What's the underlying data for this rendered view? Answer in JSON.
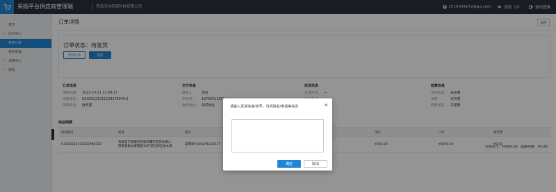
{
  "app": {
    "title": "采购平台供应商管理端",
    "company": "青岛闪动传媒科技有限公司"
  },
  "topbar": {
    "user_email": "1519334272@qq.com",
    "messages_label": "消息（2）",
    "logout_label": "退出登录"
  },
  "sidebar": {
    "items": [
      {
        "label": "首页",
        "arrow": ""
      },
      {
        "label": "比价中心",
        "arrow": "›"
      },
      {
        "label": "我的订单",
        "arrow": ""
      },
      {
        "label": "我的票据",
        "arrow": ""
      },
      {
        "label": "设置中心",
        "arrow": "›"
      },
      {
        "label": "帮助",
        "arrow": "›"
      }
    ]
  },
  "page": {
    "title": "订单详情",
    "back_label": "返回"
  },
  "status": {
    "text": "订单状态：待发货",
    "print_label": "打印订单",
    "ship_label": "发货"
  },
  "order_info": {
    "title": "订单信息",
    "rows": [
      {
        "k": "采购日期：",
        "v": "2022-10-11 11:59:17"
      },
      {
        "k": "采购单号：",
        "v": "O1920221011159176049-2"
      },
      {
        "k": "采购单位：",
        "v": "财务部"
      }
    ]
  },
  "delivery_info": {
    "title": "交付信息",
    "rows": [
      {
        "k": "联系人：",
        "v": "测试"
      },
      {
        "k": "手机号：",
        "v": "18765411851"
      },
      {
        "k": "收货地址：",
        "v": "测试地址"
      }
    ]
  },
  "receipt_info": {
    "title": "收货信息",
    "rows": [
      {
        "k": "发货时间：",
        "v": "—"
      },
      {
        "k": "发货备注：",
        "v": "—"
      }
    ]
  },
  "settle_info": {
    "title": "结算信息",
    "rows": [
      {
        "k": "合同状态：",
        "v": "未签署"
      },
      {
        "k": "发票：",
        "v": "未开票"
      },
      {
        "k": "结算状态：",
        "v": "未结算"
      }
    ]
  },
  "goods": {
    "title": "商品明细",
    "headers": [
      "商品编号",
      "商品",
      "型号",
      "数量",
      "单价",
      "小计",
      "服务费"
    ],
    "row": {
      "code": "G1920221011015988332",
      "name": "青晨官方旗舰店新款新疆阿克苏冰糖心苹果新鲜水果整箱10斤装包邮应季水果",
      "model": "蓝莓款Y1001A4112017",
      "qty": "",
      "price": "¥300.00",
      "subtotal": "¥3000.00",
      "fee": "¥0.00"
    },
    "summary": "订单合计：¥3000.00（含服务费：¥0.00）"
  },
  "modal": {
    "title": "请输入发货快递/单号，司机姓名/电话等信息",
    "textarea_value": "",
    "ok_label": "确定",
    "cancel_label": "取消"
  }
}
